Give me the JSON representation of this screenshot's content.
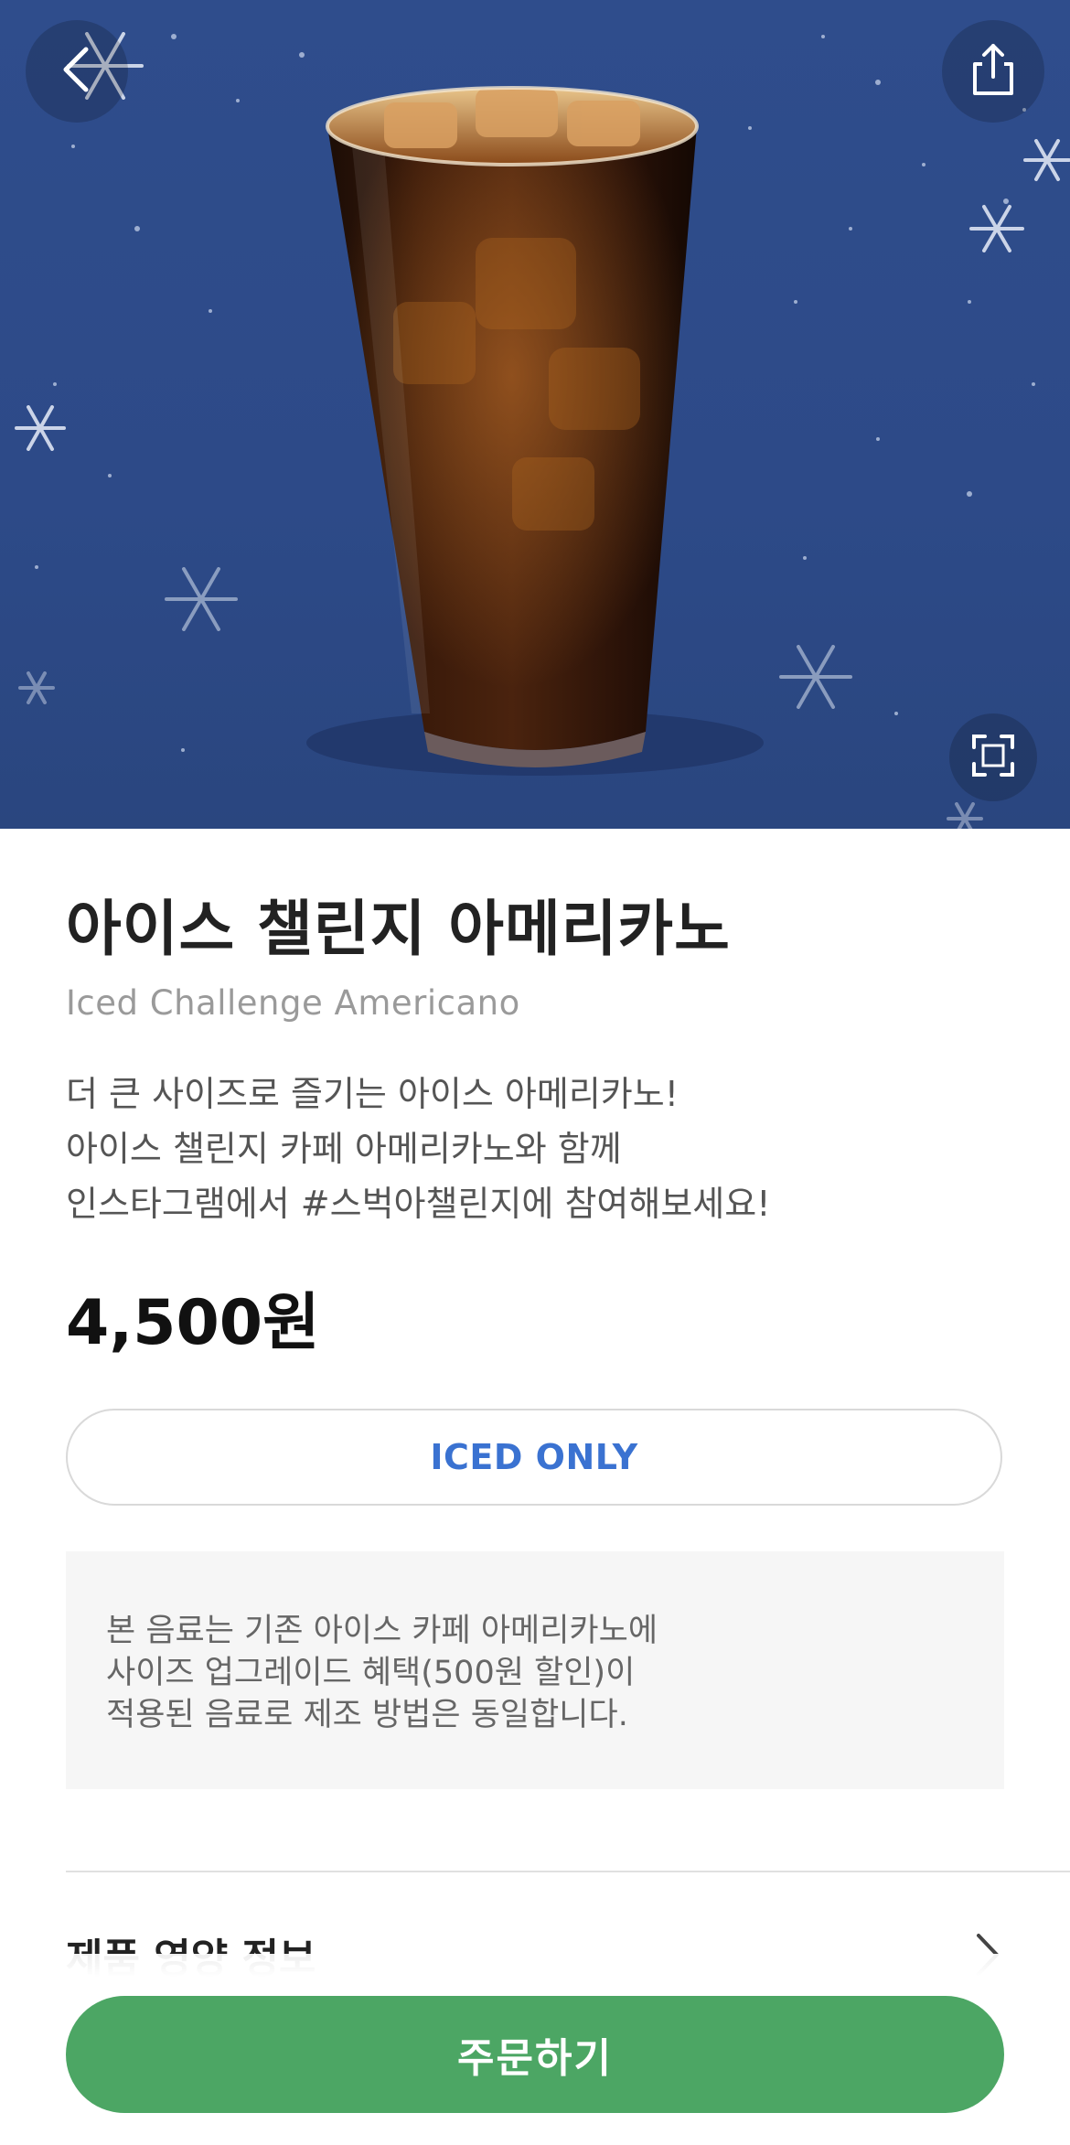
{
  "product": {
    "name_ko": "아이스 챌린지 아메리카노",
    "name_en": "Iced Challenge Americano",
    "description": [
      "더 큰 사이즈로 즐기는 아이스 아메리카노!",
      "아이스 챌린지 카페 아메리카노와 함께",
      "인스타그램에서 #스벅아챌린지에 참여해보세요!"
    ],
    "price": "4,500원",
    "temperature_option": "ICED ONLY",
    "notice": [
      "본 음료는 기존 아이스 카페 아메리카노에",
      "사이즈 업그레이드 혜택(500원 할인)이",
      "적용된 음료로 제조 방법은 동일합니다."
    ]
  },
  "sections": {
    "nutrition_label": "제품 영양 정보"
  },
  "actions": {
    "order_label": "주문하기"
  },
  "icons": {
    "back": "chevron-left-icon",
    "share": "share-icon",
    "expand": "expand-icon",
    "nutrition_arrow": "chevron-right-icon"
  },
  "colors": {
    "hero_background": "#2f4d8c",
    "accent_green": "#4ca664",
    "iced_blue": "#3a72d1"
  }
}
